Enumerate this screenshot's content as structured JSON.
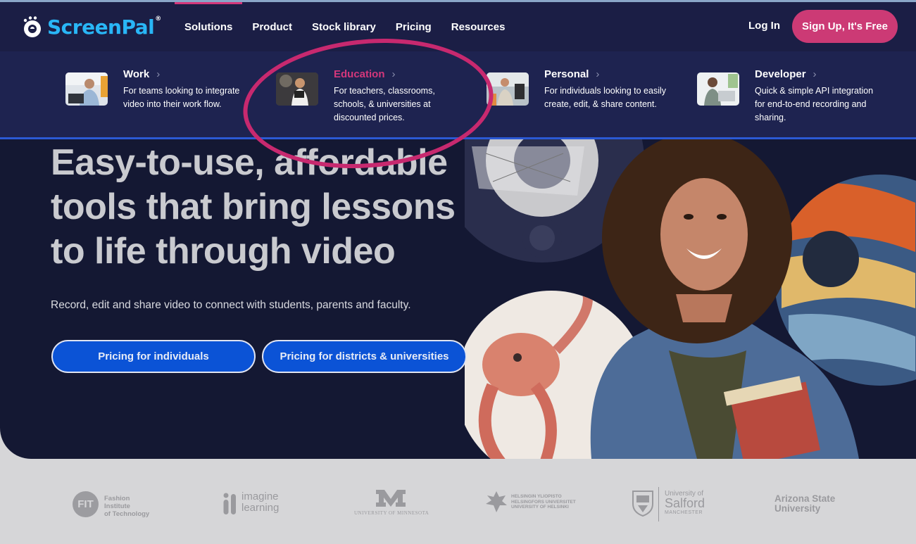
{
  "brand": {
    "name_part1": "Screen",
    "name_part2": "Pal",
    "registered": "®"
  },
  "nav": {
    "items": [
      {
        "label": "Solutions",
        "active": true
      },
      {
        "label": "Product"
      },
      {
        "label": "Stock library"
      },
      {
        "label": "Pricing"
      },
      {
        "label": "Resources"
      }
    ],
    "login": "Log In",
    "signup": "Sign Up, It's Free"
  },
  "solutions_menu": [
    {
      "title": "Work",
      "desc": "For teams looking to integrate video into their work flow."
    },
    {
      "title": "Education",
      "desc": "For teachers, classrooms, schools, & universities at discounted prices."
    },
    {
      "title": "Personal",
      "desc": "For individuals looking to easily create, edit, & share content."
    },
    {
      "title": "Developer",
      "desc": "Quick & simple API integration for end-to-end recording and sharing."
    }
  ],
  "hero": {
    "headline": "Easy-to-use, affordable tools that bring lessons to life through video",
    "subtext": "Record, edit and share video to connect with students, parents and faculty.",
    "btn_individuals": "Pricing for individuals",
    "btn_districts": "Pricing for districts & universities"
  },
  "partners": {
    "fit_mark": "FIT",
    "fit_line1": "Fashion Institute",
    "fit_line2": "of Technology",
    "imagine_line1": "imagine",
    "imagine_line2": "learning",
    "minnesota": "UNIVERSITY OF MINNESOTA",
    "helsinki_line1": "HELSINGIN YLIOPISTO",
    "helsinki_line2": "HELSINGFORS UNIVERSITET",
    "helsinki_line3": "UNIVERSITY OF HELSINKI",
    "salford_line1": "University of",
    "salford_line2": "Salford",
    "salford_line3": "MANCHESTER",
    "asu_line1": "Arizona State",
    "asu_line2": "University"
  },
  "colors": {
    "hero_bg": "#141833",
    "header_bg": "#1b1e45",
    "accent_pink": "#cc3a75",
    "brand_blue": "#29b6f6",
    "button_blue": "#0b53d6",
    "annotation": "#c7296f"
  }
}
